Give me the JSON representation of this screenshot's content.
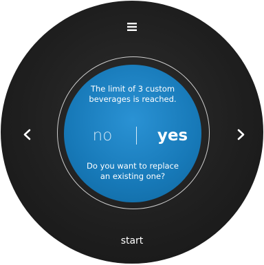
{
  "dial": {
    "menu_icon": "hamburger-menu-icon",
    "left_icon": "chevron-left-icon",
    "right_icon": "chevron-right-icon",
    "start_label": "start"
  },
  "dialog": {
    "message_top": "The limit of 3 custom\nbeverages is reached.",
    "no_label": "no",
    "yes_label": "yes",
    "message_bottom": "Do you want to replace\nan existing one?"
  },
  "colors": {
    "dial_background": "#1f1f1f",
    "screen_blue": "#1779b8",
    "ring": "#cfcfcf",
    "text": "#ffffff"
  }
}
